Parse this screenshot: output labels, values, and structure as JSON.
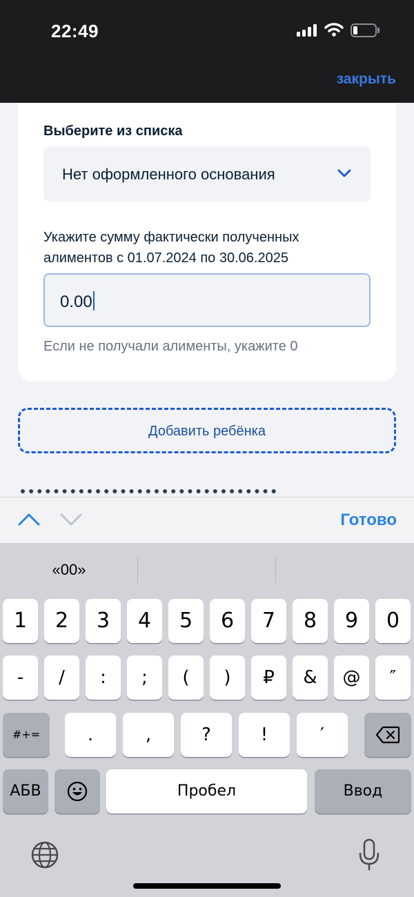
{
  "status_bar": {
    "time": "22:49"
  },
  "header": {
    "close_label": "закрыть"
  },
  "form": {
    "select_label": "Выберите из списка",
    "select_value": "Нет оформленного основания",
    "sum_label": "Укажите сумму фактически полученных алиментов с 01.07.2024 по 30.06.2025",
    "sum_value": "0.00",
    "hint": "Если не получали алименты, укажите 0",
    "add_child_label": "Добавить ребёнка"
  },
  "accessory": {
    "done_label": "Готово"
  },
  "keyboard": {
    "suggestion": "«00»",
    "row1": [
      "1",
      "2",
      "3",
      "4",
      "5",
      "6",
      "7",
      "8",
      "9",
      "0"
    ],
    "row2": [
      "-",
      "/",
      ":",
      ";",
      "(",
      ")",
      "₽",
      "&",
      "@",
      "″"
    ],
    "row3": [
      ".",
      ",",
      "?",
      "!",
      "′"
    ],
    "more_symbols": "#+=",
    "abc": "АБВ",
    "space": "Пробел",
    "enter": "Ввод"
  },
  "colors": {
    "accent": "#1f5ad1",
    "done": "#2a83e0",
    "text": "#0b1f33"
  },
  "icons": [
    "signal-icon",
    "wifi-icon",
    "battery-icon",
    "chevron-down-icon",
    "arrow-up-icon",
    "arrow-down-icon",
    "emoji-icon",
    "backspace-icon",
    "globe-icon",
    "microphone-icon"
  ]
}
